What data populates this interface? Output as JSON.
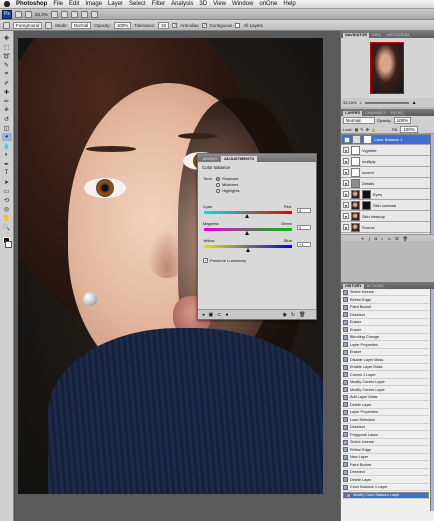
{
  "menubar": {
    "app": "Photoshop",
    "items": [
      "File",
      "Edit",
      "Image",
      "Layer",
      "Select",
      "Filter",
      "Analysis",
      "3D",
      "View",
      "Window",
      "onOne",
      "Help"
    ]
  },
  "appbar": {
    "logo": "Ps",
    "zoom": "33,3%"
  },
  "options": {
    "preset": "Foreground",
    "mode_label": "Mode:",
    "mode": "Normal",
    "opacity_label": "Opacity:",
    "opacity": "100%",
    "tolerance_label": "Tolerance:",
    "tolerance": "32",
    "antialias": "Anti-alias",
    "contiguous": "Contiguous",
    "all_layers": "All Layers"
  },
  "tools": [
    "move-icon",
    "marquee-icon",
    "lasso-icon",
    "quick-select-icon",
    "crop-icon",
    "eyedropper-icon",
    "healing-icon",
    "brush-icon",
    "clone-stamp-icon",
    "history-brush-icon",
    "eraser-icon",
    "paint-bucket-icon",
    "blur-icon",
    "dodge-icon",
    "pen-icon",
    "type-icon",
    "path-select-icon",
    "shape-icon",
    "3d-rotate-icon",
    "3d-orbit-icon",
    "hand-icon",
    "zoom-icon"
  ],
  "tool_glyphs": [
    "✥",
    "⬚",
    "➰",
    "✎",
    "⌗",
    "✐",
    "✚",
    "✏",
    "⎈",
    "↺",
    "◫",
    "◕",
    "💧",
    "◐",
    "✒",
    "T",
    "➤",
    "▭",
    "⟲",
    "◎",
    "✋",
    "🔍"
  ],
  "adjustments": {
    "tabs": [
      "MASKS",
      "ADJUSTMENTS"
    ],
    "title": "Color Balance",
    "tone_label": "Tone:",
    "tones": [
      "Shadows",
      "Midtones",
      "Highlights"
    ],
    "selected_tone": "Shadows",
    "sliders": [
      {
        "left": "Cyan",
        "right": "Red",
        "value": "0"
      },
      {
        "left": "Magenta",
        "right": "Green",
        "value": "0"
      },
      {
        "left": "Yellow",
        "right": "Blue",
        "value": "+1"
      }
    ],
    "preserve_luminosity": "Preserve Luminosity"
  },
  "navigator": {
    "tabs": [
      "NAVIGATOR",
      "INFO",
      "HISTOGRAM"
    ],
    "zoom": "33,33%"
  },
  "layers": {
    "tabs": [
      "LAYERS",
      "CHANNELS",
      "PATHS"
    ],
    "blend_mode": "Normal",
    "opacity_label": "Opacity:",
    "opacity": "100%",
    "lock_label": "Lock:",
    "fill_label": "Fill:",
    "fill": "100%",
    "items": [
      {
        "name": "Color Balance 1",
        "selected": true,
        "thumb": "white"
      },
      {
        "name": "Vignette",
        "selected": false,
        "thumb": "white"
      },
      {
        "name": "multiply",
        "selected": false,
        "thumb": "white"
      },
      {
        "name": "screen",
        "selected": false,
        "thumb": "white"
      },
      {
        "name": "Details",
        "selected": false,
        "thumb": "grey"
      },
      {
        "name": "Eyes",
        "selected": false,
        "thumb": "photo"
      },
      {
        "name": "Skin contrast",
        "selected": false,
        "thumb": "photo"
      },
      {
        "name": "Skin cleanup",
        "selected": false,
        "thumb": "photo"
      },
      {
        "name": "Source",
        "selected": false,
        "thumb": "photo"
      }
    ]
  },
  "history": {
    "tabs": [
      "HISTORY",
      "ACTIONS"
    ],
    "items": [
      "Select Inverse",
      "Refine Edge",
      "Paint Bucket",
      "Deselect",
      "Eraser",
      "Eraser",
      "Blending Change",
      "Layer Properties",
      "Eraser",
      "Disable Layer Mask",
      "Enable Layer Mask",
      "Curves 1 Layer",
      "Modify Curves Layer",
      "Modify Curves Layer",
      "Add Layer Mask",
      "Delete Layer",
      "Layer Properties",
      "Load Selection",
      "Deselect",
      "Polygonal Lasso",
      "Select Inverse",
      "Refine Edge",
      "New Layer",
      "Paint Bucket",
      "Deselect",
      "Delete Layer",
      "Color Balance 1 Layer",
      "Modify Color Balance Layer"
    ],
    "selected_index": 27
  },
  "colors": {
    "accent": "#3f6fd1",
    "panel": "#d9d9d9",
    "dock": "#b9b9b9"
  }
}
